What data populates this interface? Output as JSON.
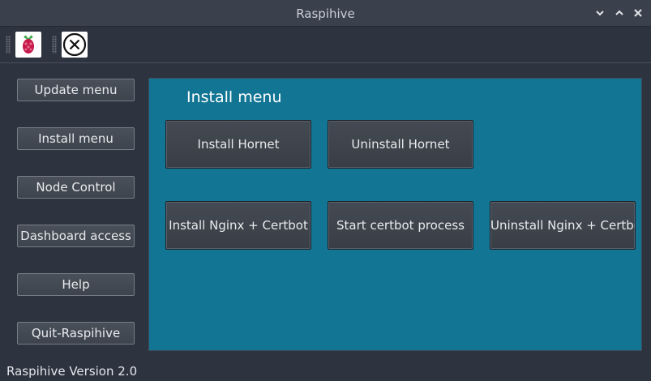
{
  "window": {
    "title": "Raspihive",
    "controls": [
      "chevron-down-icon",
      "chevron-up-icon",
      "close-icon"
    ]
  },
  "toolbar": {
    "items": [
      {
        "icon": "raspberry-pi-logo-icon"
      },
      {
        "icon": "circle-x-icon"
      }
    ]
  },
  "sidebar": {
    "items": [
      {
        "label": "Update menu"
      },
      {
        "label": "Install menu"
      },
      {
        "label": "Node Control"
      },
      {
        "label": "Dashboard access"
      },
      {
        "label": "Help"
      },
      {
        "label": "Quit-Raspihive"
      }
    ]
  },
  "main": {
    "title": "Install menu",
    "buttons": [
      {
        "label": "Install Hornet"
      },
      {
        "label": "Uninstall Hornet"
      },
      {
        "label": "Install Nginx + Certbot"
      },
      {
        "label": "Start certbot process"
      },
      {
        "label": "Uninstall Nginx + Certbot"
      }
    ]
  },
  "status": {
    "text": "Raspihive Version 2.0"
  },
  "colors": {
    "background": "#2d3440",
    "titlebar": "#3a414d",
    "panel": "#137594",
    "button": "#3e444e",
    "text": "#e8eaed"
  }
}
